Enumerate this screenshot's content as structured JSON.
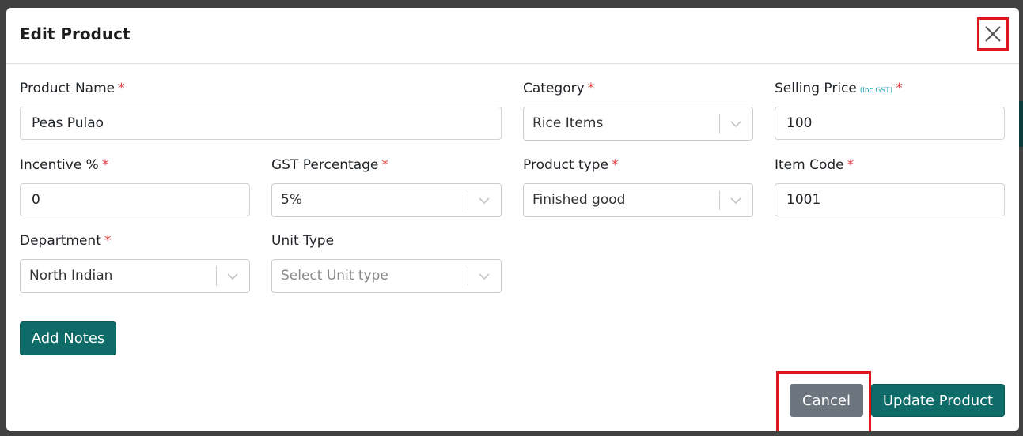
{
  "modal": {
    "title": "Edit Product",
    "close_icon": "close-icon"
  },
  "fields": {
    "product_name": {
      "label": "Product Name",
      "required": "*",
      "value": "Peas Pulao"
    },
    "category": {
      "label": "Category",
      "required": "*",
      "value": "Rice Items"
    },
    "selling_price": {
      "label": "Selling Price",
      "hint": "(inc GST)",
      "required": "*",
      "value": "100"
    },
    "incentive": {
      "label": "Incentive %",
      "required": "*",
      "value": "0"
    },
    "gst_percentage": {
      "label": "GST Percentage",
      "required": "*",
      "value": "5%"
    },
    "product_type": {
      "label": "Product type",
      "required": "*",
      "value": "Finished good"
    },
    "item_code": {
      "label": "Item Code",
      "required": "*",
      "value": "1001"
    },
    "department": {
      "label": "Department",
      "required": "*",
      "value": "North Indian"
    },
    "unit_type": {
      "label": "Unit Type",
      "placeholder": "Select Unit type"
    }
  },
  "buttons": {
    "add_notes": "Add Notes",
    "cancel": "Cancel",
    "update_product": "Update Product"
  },
  "colors": {
    "accent_teal": "#0f6b68",
    "cancel_grey": "#6c757d",
    "required_red": "#e23d3d",
    "highlight_red": "#e0161c",
    "hint_teal": "#1aa3b7"
  }
}
